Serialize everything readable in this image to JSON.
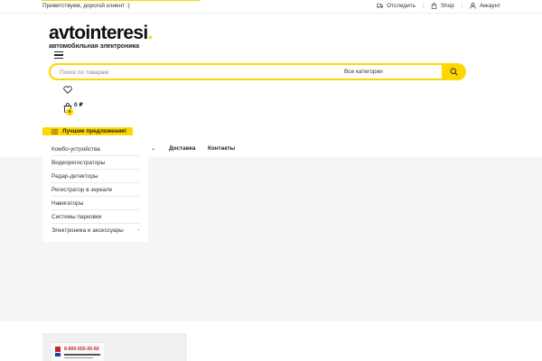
{
  "topbar": {
    "welcome": "Приветствуем, дорогой клиент :)",
    "links": [
      {
        "label": "Отследить",
        "icon": "truck-icon"
      },
      {
        "label": "Shop",
        "icon": "bag-icon"
      },
      {
        "label": "Аккаунт",
        "icon": "user-icon"
      }
    ]
  },
  "logo": {
    "word": "avtointeresi",
    "dot": ".",
    "tagline": "автомобильная электроника"
  },
  "search": {
    "placeholder": "Поиск по товарам",
    "category": "Все категории"
  },
  "cart": {
    "count": "0",
    "total": "0 ₽"
  },
  "offers_button": {
    "label": "Лучшие предложения!"
  },
  "nav": {
    "items": [
      "Доставка",
      "Контакты"
    ]
  },
  "dropdown": {
    "items": [
      "Комбо-устройства",
      "Видеорегистраторы",
      "Радар-детекторы",
      "Регистратор в зеркале",
      "Навигаторы",
      "Системы парковки",
      "Электроника и аксессуары"
    ]
  },
  "banner": {
    "phone": "8-800-555-05-60"
  },
  "colors": {
    "accent": "#fed700",
    "background_main": "#f5f5f5",
    "text": "#333333"
  }
}
